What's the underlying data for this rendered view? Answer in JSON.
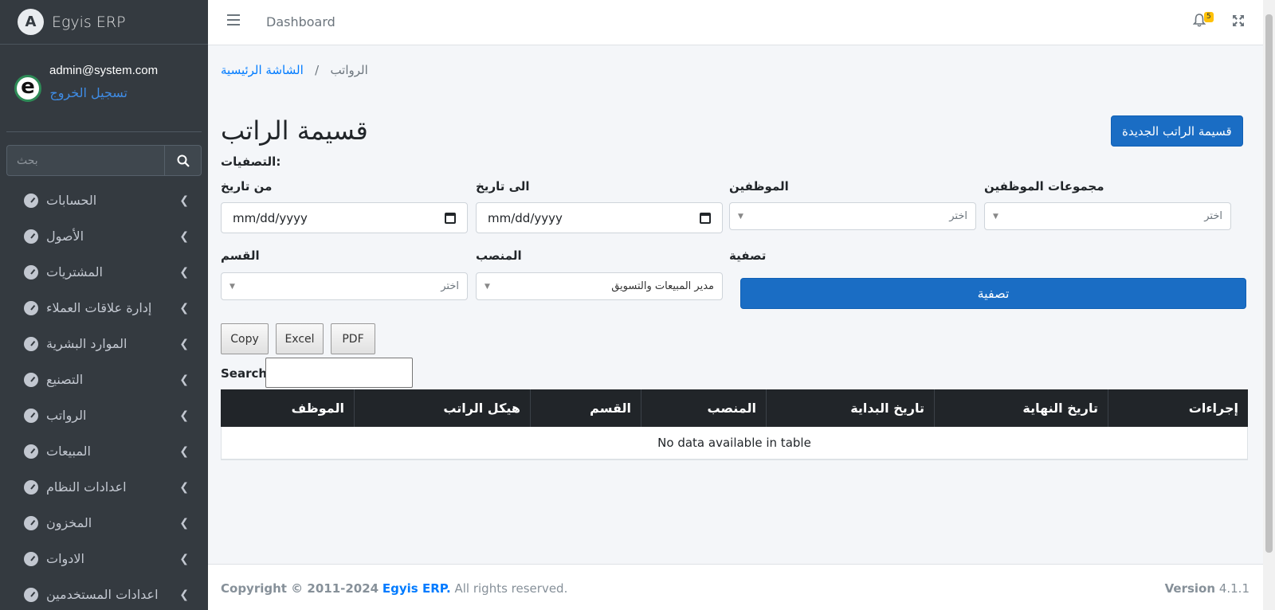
{
  "brand": {
    "name": "Egyis ERP",
    "logo_letter": "A"
  },
  "user": {
    "email": "admin@system.com",
    "logout_label": "تسجيل الخروج",
    "avatar_letter": "e"
  },
  "sidebar": {
    "search_placeholder": "بحث",
    "items": [
      {
        "label": "الحسابات"
      },
      {
        "label": "الأصول"
      },
      {
        "label": "المشتريات"
      },
      {
        "label": "إدارة علاقات العملاء"
      },
      {
        "label": "الموارد البشرية"
      },
      {
        "label": "التصنيع"
      },
      {
        "label": "الرواتب"
      },
      {
        "label": "المبيعات"
      },
      {
        "label": "اعدادات النظام"
      },
      {
        "label": "المخزون"
      },
      {
        "label": "الادوات"
      },
      {
        "label": "اعدادات المستخدمين"
      }
    ]
  },
  "header": {
    "title": "Dashboard",
    "notification_count": "5"
  },
  "breadcrumb": {
    "home": "الشاشة الرئيسية",
    "separator": "/",
    "current": "الرواتب"
  },
  "page": {
    "title": "قسيمة الراتب",
    "new_button": "قسيمة الراتب الجديدة"
  },
  "filters": {
    "title": "التصفيات:",
    "from_date_label": "من تاريخ",
    "from_date_value": "mm/dd/yyyy",
    "to_date_label": "الى تاريخ",
    "to_date_value": "mm/dd/yyyy",
    "employees_label": "الموظفين",
    "employees_value": "اختر",
    "employee_groups_label": "مجموعات الموظفين",
    "employee_groups_value": "اختر",
    "department_label": "القسم",
    "department_value": "اختر",
    "position_label": "المنصب",
    "position_value": "مدير المبيعات والتسويق",
    "filter_label": "تصفية",
    "filter_button": "تصفية"
  },
  "datatable": {
    "buttons": [
      "Copy",
      "Excel",
      "PDF"
    ],
    "search_label": "Search:",
    "columns": [
      "الموظف",
      "هيكل الراتب",
      "القسم",
      "المنصب",
      "تاريخ البداية",
      "تاريخ النهاية",
      "إجراءات"
    ],
    "empty_message": "No data available in table"
  },
  "footer": {
    "copyright_prefix": "Copyright © 2011-2024",
    "company": "Egyis ERP.",
    "rights": "All rights reserved.",
    "version_label": "Version",
    "version_value": "4.1.1"
  },
  "colors": {
    "primary": "#1a6dc4",
    "sidebar_bg": "#343a40",
    "table_header_bg": "#212529",
    "badge": "#ffc107"
  }
}
